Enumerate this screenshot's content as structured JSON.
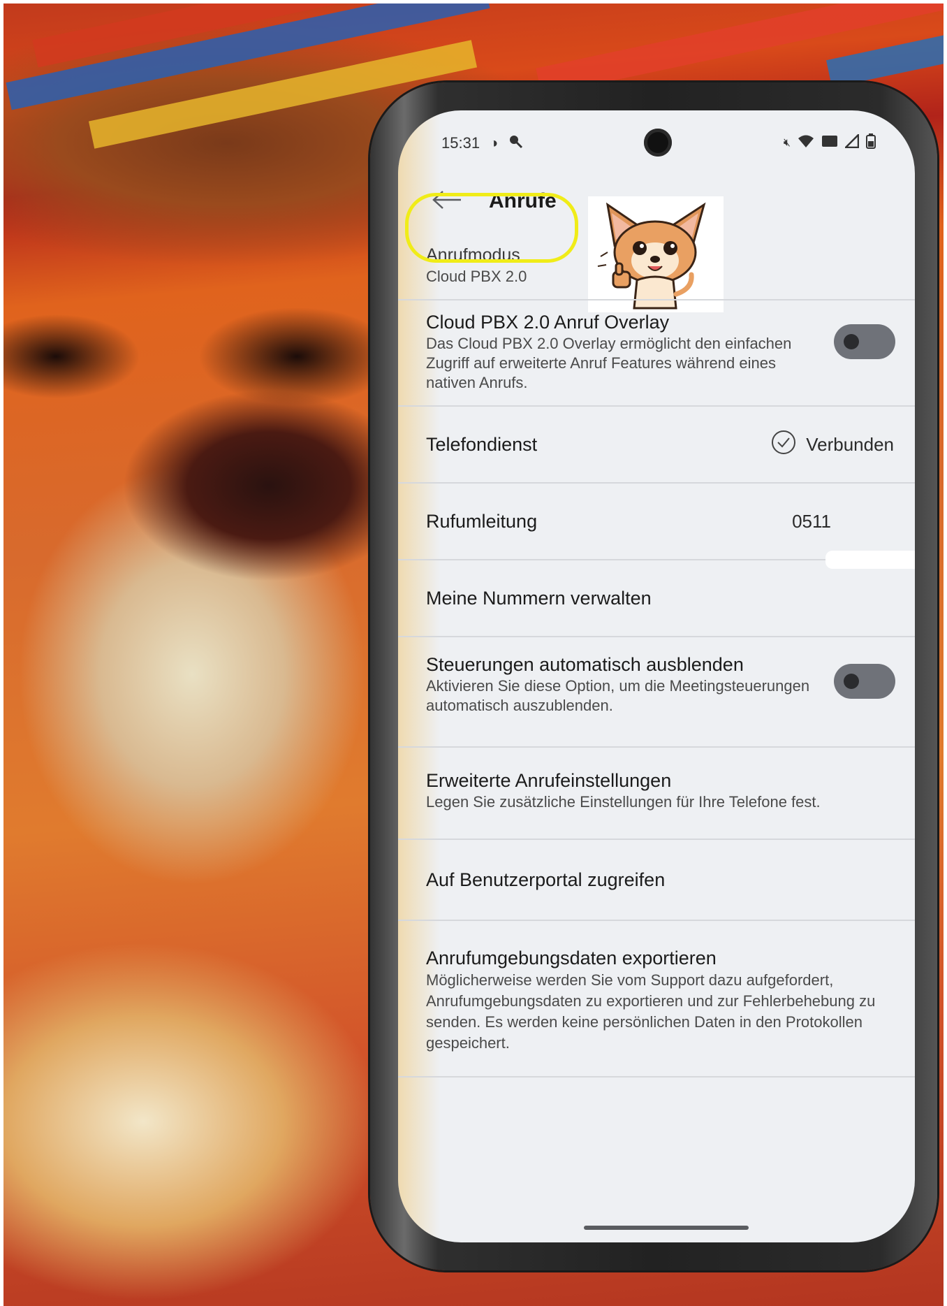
{
  "status_bar": {
    "time": "15:31",
    "left_icons": [
      "alarm-icon",
      "search-icon"
    ],
    "right_icons": [
      "mute-icon",
      "wifi-icon",
      "data-icon",
      "signal-icon",
      "battery-icon"
    ]
  },
  "header": {
    "title": "Anrufe",
    "back_icon": "arrow-left-icon"
  },
  "settings": {
    "call_mode": {
      "title": "Anrufmodus",
      "value": "Cloud PBX 2.0"
    },
    "overlay": {
      "title": "Cloud PBX 2.0 Anruf Overlay",
      "description": "Das Cloud PBX 2.0 Overlay ermöglicht den einfachen Zugriff auf erweiterte Anruf Features während eines nativen Anrufs.",
      "enabled": false
    },
    "phone_service": {
      "title": "Telefondienst",
      "status": "Verbunden",
      "status_icon": "check-circle-icon"
    },
    "forwarding": {
      "title": "Rufumleitung",
      "value": "0511"
    },
    "manage_numbers": {
      "title": "Meine Nummern verwalten"
    },
    "auto_hide": {
      "title": "Steuerungen automatisch ausblenden",
      "description": "Aktivieren Sie diese Option, um die Meetingsteuerungen automatisch auszublenden.",
      "enabled": false
    },
    "advanced": {
      "title": "Erweiterte Anrufeinstellungen",
      "description": "Legen Sie zusätzliche Einstellungen für Ihre Telefone fest."
    },
    "portal": {
      "title": "Auf Benutzerportal zugreifen"
    },
    "export": {
      "title": "Anrufumgebungsdaten exportieren",
      "description": "Möglicherweise werden Sie vom Support dazu aufgefordert, Anrufumgebungsdaten zu exportieren und zur Fehlerbehebung zu senden. Es werden keine persönlichen Daten in den Protokollen gespeichert."
    }
  },
  "colors": {
    "highlight": "#f0ec18",
    "screen_bg": "#eef0f3",
    "toggle_off": "#6f7279"
  }
}
